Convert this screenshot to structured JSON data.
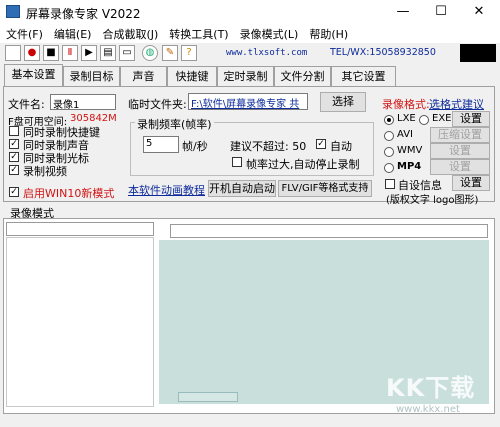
{
  "window": {
    "title": "屏幕录像专家 V2022",
    "minimize": "—",
    "maximize": "☐",
    "close": "✕"
  },
  "menu": [
    "文件(F)",
    "编辑(E)",
    "合成截取(J)",
    "转换工具(T)",
    "录像模式(L)",
    "帮助(H)"
  ],
  "toolbar": {
    "site": "www.tlxsoft.com",
    "tel": "TEL/WX:15058932850"
  },
  "tabs": [
    "基本设置",
    "录制目标",
    "声音",
    "快捷键",
    "定时录制",
    "文件分割",
    "其它设置"
  ],
  "basic": {
    "filename_label": "文件名:",
    "filename_value": "录像1",
    "temp_folder_label": "临时文件夹:",
    "temp_folder_value": "F:\\软件\\屏幕录像专家 共",
    "select_btn": "选择",
    "disk_label": "F盘可用空间:",
    "disk_value": "305842M",
    "checks": [
      {
        "label": "同时录制快捷键",
        "checked": false
      },
      {
        "label": "同时录制声音",
        "checked": true
      },
      {
        "label": "同时录制光标",
        "checked": true
      },
      {
        "label": "录制视频",
        "checked": true
      }
    ],
    "win10_label": "启用WIN10新模式",
    "win10_checked": true
  },
  "fps": {
    "group_title": "录制频率(帧率)",
    "value": "5",
    "unit": "帧/秒",
    "suggest": "建议不超过: 50",
    "auto_label": "自动",
    "auto_checked": true,
    "stop_label": "帧率过大,自动停止录制",
    "stop_checked": false
  },
  "links": {
    "tutorial": "本软件动画教程",
    "autostart": "开机自动启动",
    "flv": "FLV/GIF等格式支持"
  },
  "format": {
    "title": "录像格式:",
    "suggest": "选格式建议",
    "lxe": "LXE",
    "exe": "EXE",
    "settings": "设置",
    "avi": "AVI",
    "compress": "压缩设置",
    "wmv": "WMV",
    "wmv_set": "设置",
    "mp4": "MP4",
    "mp4_set": "设置",
    "selfinfo": "自设信息",
    "selfinfo_set": "设置",
    "copyright": "(版权文字 logo图形)"
  },
  "mode_label": "录像模式",
  "watermark": {
    "logo": "KK下载",
    "url": "www.kkx.net"
  },
  "colors": {
    "accent": "#0d2b9a",
    "red": "#d21414",
    "preview": "#c9dfdc"
  }
}
